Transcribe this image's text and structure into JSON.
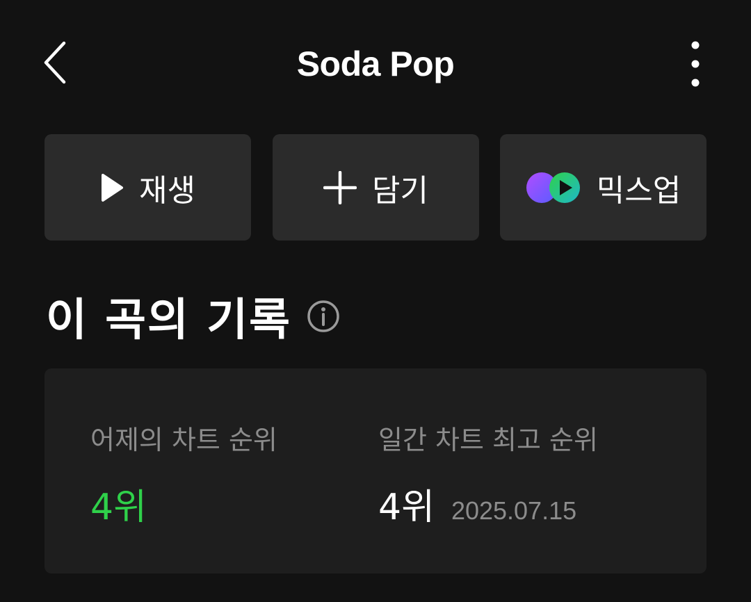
{
  "header": {
    "title": "Soda Pop"
  },
  "actions": {
    "play_label": "재생",
    "add_label": "담기",
    "mix_label": "믹스업"
  },
  "section": {
    "title": "이 곡의 기록"
  },
  "stats": {
    "yesterday_label": "어제의 차트 순위",
    "yesterday_value": "4위",
    "best_label": "일간 차트 최고 순위",
    "best_value": "4위",
    "best_date": "2025.07.15"
  },
  "colors": {
    "background": "#121212",
    "button_bg": "#2b2b2b",
    "card_bg": "#1e1e1e",
    "accent_green": "#2fd14a",
    "muted_text": "#8c8c8c"
  },
  "icons": {
    "back": "chevron-left-icon",
    "more": "more-vertical-icon",
    "play": "play-icon",
    "add": "plus-icon",
    "mix": "mixup-logo-icon",
    "info": "info-icon"
  }
}
